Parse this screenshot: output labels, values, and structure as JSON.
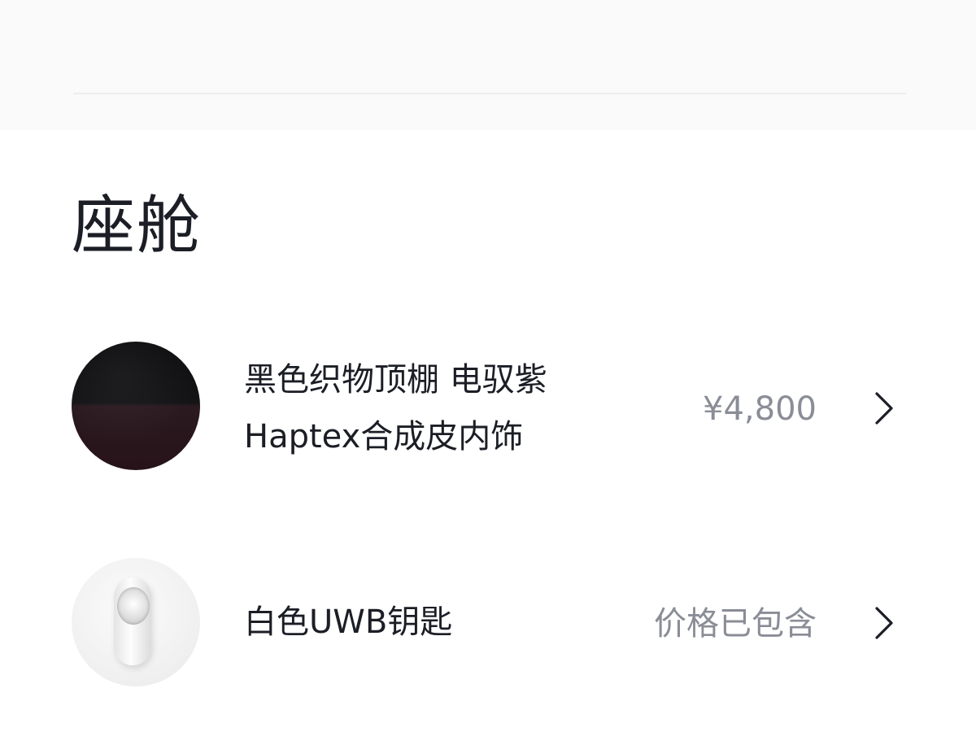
{
  "section": {
    "title": "座舱"
  },
  "options": [
    {
      "label_line1": "黑色织物顶棚 电驭紫",
      "label_line2": "Haptex合成皮内饰",
      "price": "¥4,800",
      "thumbnail_icon": "interior-swatch",
      "chevron_icon": "chevron-right-icon"
    },
    {
      "label_line1": "白色UWB钥匙",
      "price": "价格已包含",
      "thumbnail_icon": "uwb-key",
      "chevron_icon": "chevron-right-icon"
    }
  ],
  "colors": {
    "title_text": "#1c1e26",
    "label_text": "#1c1e26",
    "price_text": "#8a8d96",
    "chevron": "#1c1e26",
    "top_panel": "#fafafa",
    "divider": "#ececec"
  }
}
